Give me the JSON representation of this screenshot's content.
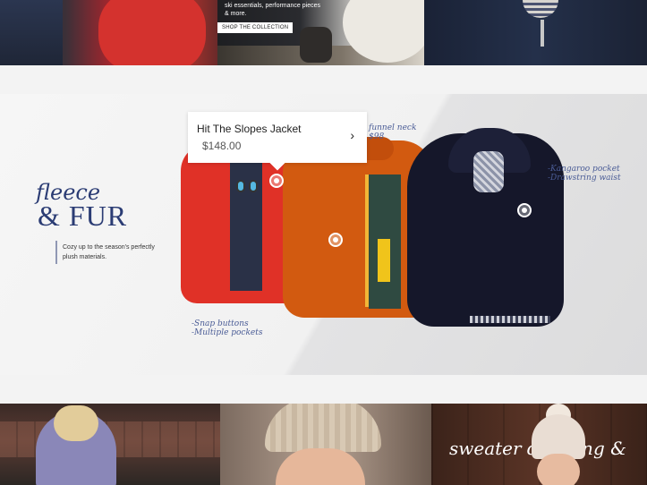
{
  "top_banner": {
    "description_text": "ski essentials, performance pieces & more.",
    "cta_label": "SHOP THE COLLECTION"
  },
  "fleece_section": {
    "title_script": "fleece",
    "title_main": "& FUR",
    "description": "Cozy up to the season's perfectly plush materials.",
    "annotations": {
      "red_jacket": "-Snap buttons\n-Multiple pockets",
      "orange_jacket": "funnel neck\n$98",
      "navy_jacket": "-Kangaroo pocket\n-Drawstring waist"
    },
    "tooltip": {
      "product_name": "Hit The Slopes Jacket",
      "price": "$148.00",
      "chevron": "›"
    }
  },
  "bottom_banner": {
    "title": "sweater dressing &"
  }
}
